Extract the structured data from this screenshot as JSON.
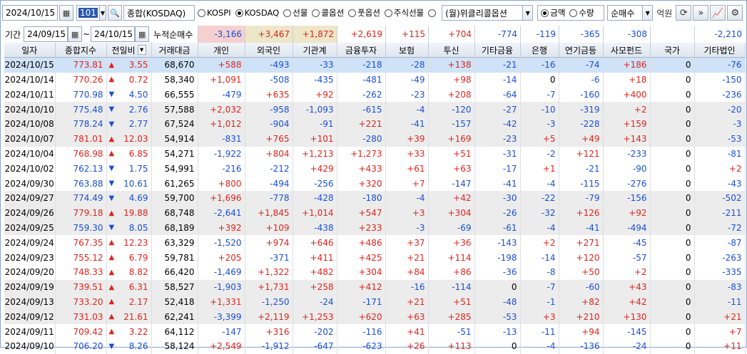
{
  "toolbar": {
    "date": "2024/10/15",
    "code": "101",
    "index_name": "종합(KOSDAQ)",
    "markets": [
      {
        "label": "KOSPI",
        "selected": false
      },
      {
        "label": "KOSDAQ",
        "selected": true
      },
      {
        "label": "선물",
        "selected": false
      },
      {
        "label": "콜옵션",
        "selected": false
      },
      {
        "label": "풋옵션",
        "selected": false
      },
      {
        "label": "주식선물",
        "selected": false
      },
      {
        "label": "",
        "selected": false
      }
    ],
    "weekly_option": "(월)위클리콜옵션",
    "amount_label": "금액",
    "quantity_label": "수량",
    "amount_selected": true,
    "net_type": "순매수",
    "unit": "억원"
  },
  "period": {
    "label": "기간",
    "from": "24/09/15",
    "tilde": "~",
    "to": "24/10/15",
    "cum_label": "누적순매수"
  },
  "sums": [
    "-3,166",
    "+3,467",
    "+1,872",
    "+2,619",
    "+115",
    "+704",
    "-774",
    "-119",
    "-365",
    "-308",
    "",
    "-2,210"
  ],
  "columns": [
    "일자",
    "종합지수",
    "전일비",
    "거래대금",
    "개인",
    "외국인",
    "기관계",
    "금융투자",
    "보험",
    "투신",
    "기타금융",
    "은행",
    "연기금등",
    "사모펀드",
    "국가",
    "기타법인"
  ],
  "rows": [
    [
      "2024/10/15",
      "773.81",
      "up",
      "3.55",
      "68,670",
      "+588",
      "-493",
      "-33",
      "-218",
      "-28",
      "+138",
      "-21",
      "-16",
      "-74",
      "+186",
      "0",
      "-76"
    ],
    [
      "2024/10/14",
      "770.26",
      "up",
      "0.72",
      "58,340",
      "+1,091",
      "-508",
      "-435",
      "-481",
      "-49",
      "+98",
      "-14",
      "0",
      "-6",
      "+18",
      "0",
      "-150"
    ],
    [
      "2024/10/11",
      "770.98",
      "dn",
      "4.50",
      "66,555",
      "-479",
      "+635",
      "+92",
      "-262",
      "-23",
      "+208",
      "-64",
      "-7",
      "-160",
      "+400",
      "0",
      "-236"
    ],
    [
      "2024/10/10",
      "775.48",
      "dn",
      "2.76",
      "57,588",
      "+2,032",
      "-958",
      "-1,093",
      "-615",
      "-4",
      "-120",
      "-27",
      "-10",
      "-319",
      "+2",
      "0",
      "-20"
    ],
    [
      "2024/10/08",
      "778.24",
      "dn",
      "2.77",
      "67,524",
      "+1,012",
      "-904",
      "-91",
      "+221",
      "-41",
      "-157",
      "-42",
      "-3",
      "-228",
      "+159",
      "0",
      "-3"
    ],
    [
      "2024/10/07",
      "781.01",
      "up",
      "12.03",
      "54,914",
      "-831",
      "+765",
      "+101",
      "-280",
      "+39",
      "+169",
      "-23",
      "+5",
      "+49",
      "+143",
      "0",
      "-53"
    ],
    [
      "2024/10/04",
      "768.98",
      "up",
      "6.85",
      "54,271",
      "-1,922",
      "+804",
      "+1,213",
      "+1,273",
      "+33",
      "+51",
      "-31",
      "-2",
      "+121",
      "-233",
      "0",
      "-81"
    ],
    [
      "2024/10/02",
      "762.13",
      "dn",
      "1.75",
      "54,991",
      "-216",
      "-212",
      "+429",
      "+433",
      "+61",
      "+63",
      "-17",
      "+1",
      "-21",
      "-90",
      "0",
      "+2"
    ],
    [
      "2024/09/30",
      "763.88",
      "dn",
      "10.61",
      "61,265",
      "+800",
      "-494",
      "-256",
      "+320",
      "+7",
      "-147",
      "-41",
      "-4",
      "-115",
      "-276",
      "0",
      "-43"
    ],
    [
      "2024/09/27",
      "774.49",
      "dn",
      "4.69",
      "59,700",
      "+1,696",
      "-778",
      "-428",
      "-180",
      "-4",
      "+42",
      "-30",
      "-22",
      "-79",
      "-156",
      "0",
      "-502"
    ],
    [
      "2024/09/26",
      "779.18",
      "up",
      "19.88",
      "68,748",
      "-2,641",
      "+1,845",
      "+1,014",
      "+547",
      "+3",
      "+304",
      "-26",
      "-32",
      "+126",
      "+92",
      "0",
      "-211"
    ],
    [
      "2024/09/25",
      "759.30",
      "dn",
      "8.05",
      "68,189",
      "+392",
      "+109",
      "-438",
      "+233",
      "-3",
      "-69",
      "-61",
      "-4",
      "-41",
      "-494",
      "0",
      "-72"
    ],
    [
      "2024/09/24",
      "767.35",
      "up",
      "12.23",
      "63,329",
      "-1,520",
      "+974",
      "+646",
      "+486",
      "+37",
      "+36",
      "-143",
      "+2",
      "+271",
      "-45",
      "0",
      "-87"
    ],
    [
      "2024/09/23",
      "755.12",
      "up",
      "6.79",
      "59,781",
      "+205",
      "-371",
      "+411",
      "+425",
      "+21",
      "+114",
      "-198",
      "-14",
      "+120",
      "-57",
      "0",
      "-263"
    ],
    [
      "2024/09/20",
      "748.33",
      "up",
      "8.82",
      "66,420",
      "-1,469",
      "+1,322",
      "+482",
      "+304",
      "+84",
      "+86",
      "-36",
      "-8",
      "+50",
      "+2",
      "0",
      "-335"
    ],
    [
      "2024/09/19",
      "739.51",
      "up",
      "6.31",
      "58,527",
      "-1,903",
      "+1,731",
      "+258",
      "+412",
      "-16",
      "-114",
      "0",
      "-7",
      "-60",
      "+43",
      "0",
      "-83"
    ],
    [
      "2024/09/13",
      "733.20",
      "up",
      "2.17",
      "52,418",
      "+1,331",
      "-1,250",
      "-24",
      "-171",
      "+21",
      "+51",
      "-48",
      "-1",
      "+82",
      "+42",
      "0",
      "-11"
    ],
    [
      "2024/09/12",
      "731.03",
      "up",
      "21.61",
      "62,241",
      "-3,399",
      "+2,119",
      "+1,253",
      "+620",
      "+63",
      "+285",
      "-53",
      "+3",
      "+210",
      "+130",
      "0",
      "+21"
    ],
    [
      "2024/09/11",
      "709.42",
      "up",
      "3.22",
      "64,112",
      "-147",
      "+316",
      "-202",
      "-116",
      "+41",
      "-51",
      "-13",
      "-11",
      "+94",
      "-145",
      "0",
      "+7"
    ],
    [
      "2024/09/10",
      "706.20",
      "dn",
      "8.26",
      "58,124",
      "+2,549",
      "-1,912",
      "-647",
      "-623",
      "+26",
      "+113",
      "0",
      "-4",
      "-136",
      "-24",
      "0",
      "+11"
    ]
  ],
  "colors": {
    "up": "#e0241c",
    "down": "#1a4fd6",
    "selected_row": "#cfe2f7",
    "alt_row": "#ececec"
  }
}
